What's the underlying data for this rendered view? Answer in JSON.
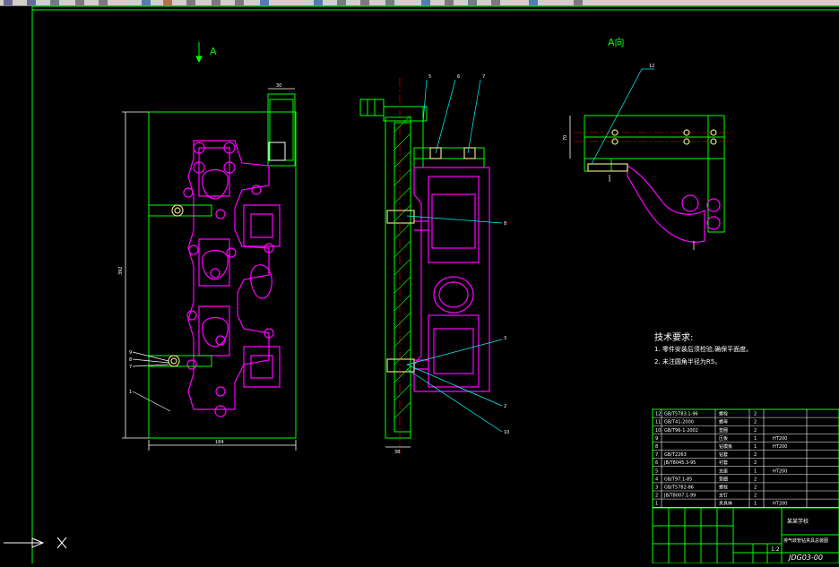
{
  "view_labels": {
    "section_a": "A",
    "view_a": "A向"
  },
  "tech_requirements": {
    "title": "技术要求:",
    "items": [
      "1. 零件安装后须检验,确保平面度。",
      "2. 未注圆角半径为R5。"
    ]
  },
  "title_block": {
    "drawing_no": "JDG03-00",
    "scale": "1:2",
    "name": "排气歧管钻夹具总装图",
    "org": "某某学校"
  },
  "bom": [
    {
      "no": "12",
      "code": "GB/T5783.1-96",
      "name": "螺栓",
      "qty": "2",
      "material": ""
    },
    {
      "no": "11",
      "code": "GB/T41-2000",
      "name": "螺母",
      "qty": "2",
      "material": ""
    },
    {
      "no": "10",
      "code": "GB/T96-1-2002",
      "name": "垫圈",
      "qty": "2",
      "material": ""
    },
    {
      "no": "9",
      "code": "",
      "name": "压板",
      "qty": "1",
      "material": "HT200"
    },
    {
      "no": "8",
      "code": "",
      "name": "钻模板",
      "qty": "1",
      "material": "HT200"
    },
    {
      "no": "7",
      "code": "GB/T2263",
      "name": "钻套",
      "qty": "2",
      "material": ""
    },
    {
      "no": "6",
      "code": "JB/T8045.3-95",
      "name": "衬套",
      "qty": "2",
      "material": ""
    },
    {
      "no": "5",
      "code": "",
      "name": "支座",
      "qty": "1",
      "material": "HT200"
    },
    {
      "no": "4",
      "code": "GB/T97.1-85",
      "name": "垫圈",
      "qty": "2",
      "material": ""
    },
    {
      "no": "3",
      "code": "GB/T5782-86",
      "name": "螺栓",
      "qty": "2",
      "material": ""
    },
    {
      "no": "2",
      "code": "JB/T8007.1-99",
      "name": "支钉",
      "qty": "2",
      "material": ""
    },
    {
      "no": "1",
      "code": "",
      "name": "夹具体",
      "qty": "1",
      "material": "HT200"
    }
  ],
  "colors": {
    "background": "#000000",
    "frame": "#00ff00",
    "part": "#ff00ff",
    "leader": "#00ffff",
    "dimension": "#ffffff",
    "cutline": "#ff0000"
  },
  "icons": {
    "ucs": "ucs-icon"
  }
}
